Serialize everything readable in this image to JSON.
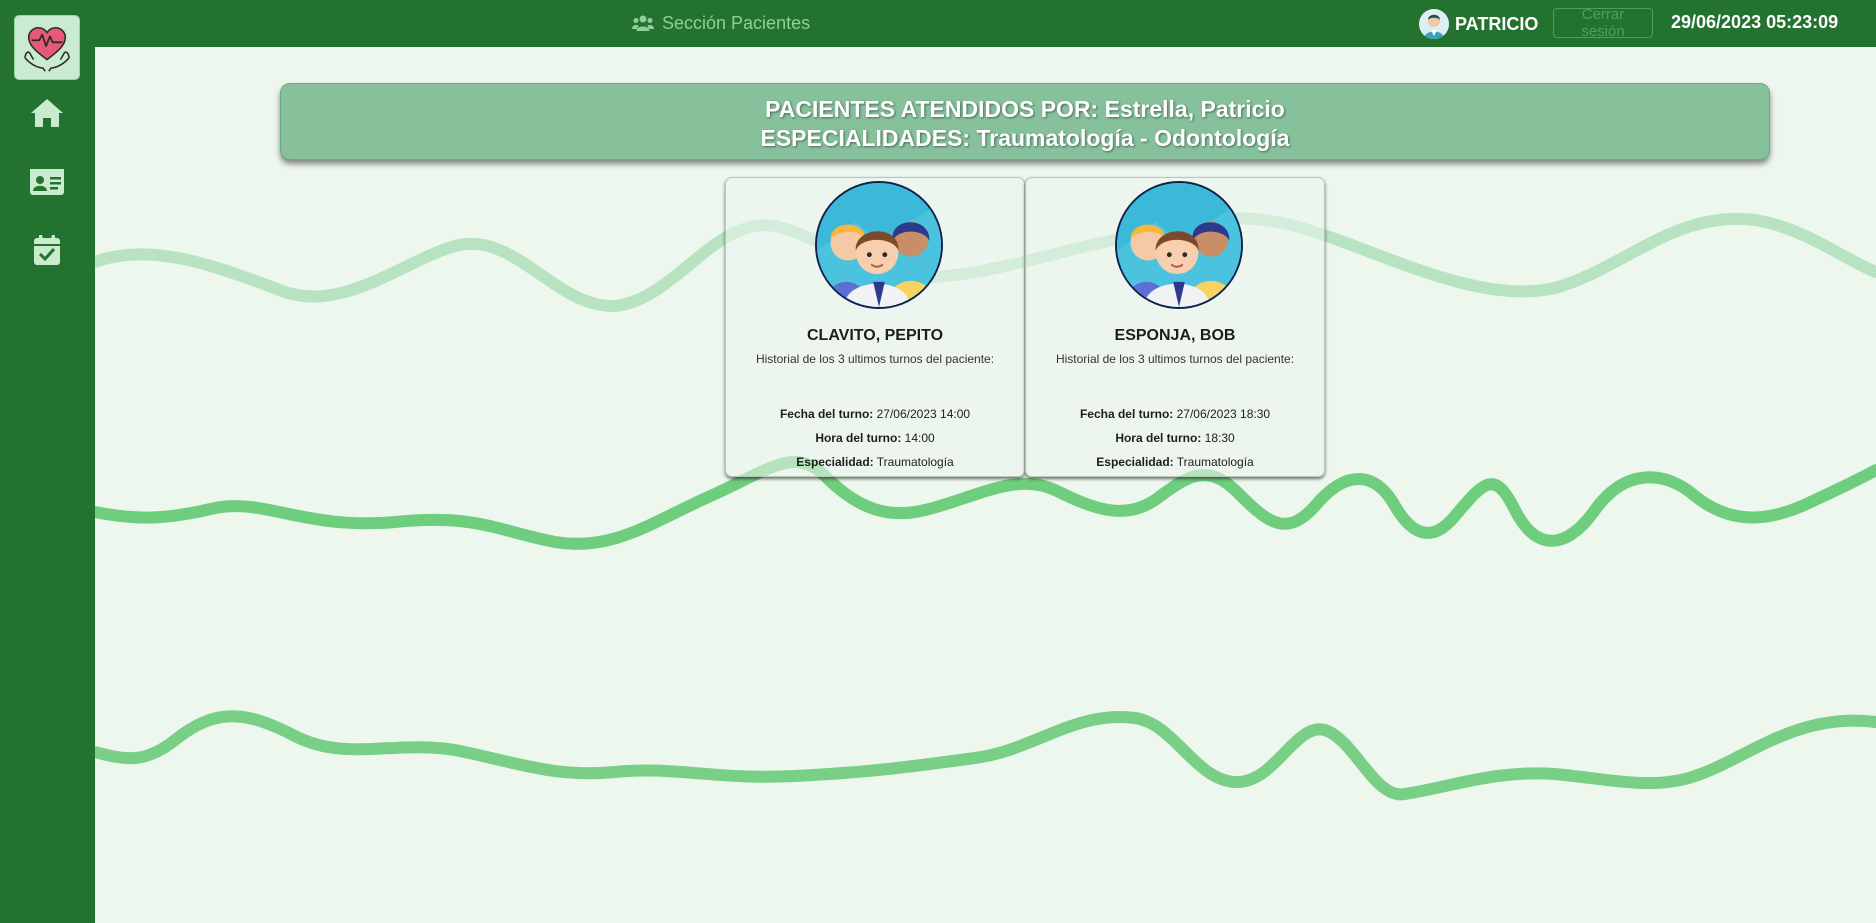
{
  "topbar": {
    "section_icon": "users-icon",
    "section_label": "Sección Pacientes",
    "user_icon": "doctor-avatar-icon",
    "user_name": "PATRICIO",
    "logout_label": "Cerrar sesión",
    "datetime": "29/06/2023 05:23:09"
  },
  "sidebar": {
    "logo_icon": "heart-hands-logo-icon",
    "items": [
      {
        "icon": "home-icon"
      },
      {
        "icon": "id-card-icon"
      },
      {
        "icon": "calendar-check-icon"
      }
    ]
  },
  "header": {
    "line1": "PACIENTES ATENDIDOS POR: Estrella, Patricio",
    "line2": "ESPECIALIDADES: Traumatología - Odontología"
  },
  "patients": [
    {
      "name": "CLAVITO, PEPITO",
      "history_label": "Historial de los 3 ultimos turnos del paciente:",
      "date_label": "Fecha del turno:",
      "date_value": "27/06/2023 14:00",
      "time_label": "Hora del turno:",
      "time_value": "14:00",
      "specialty_label": "Especialidad:",
      "specialty_value": "Traumatología"
    },
    {
      "name": "ESPONJA, BOB",
      "history_label": "Historial de los 3 ultimos turnos del paciente:",
      "date_label": "Fecha del turno:",
      "date_value": "27/06/2023 18:30",
      "time_label": "Hora del turno:",
      "time_value": "18:30",
      "specialty_label": "Especialidad:",
      "specialty_value": "Traumatología"
    }
  ],
  "colors": {
    "primary": "#237230",
    "header_bg": "#86c19b",
    "page_bg": "#edf7ee",
    "wave_light": "#b6e3bf",
    "wave_dark": "#6fcd7e"
  }
}
